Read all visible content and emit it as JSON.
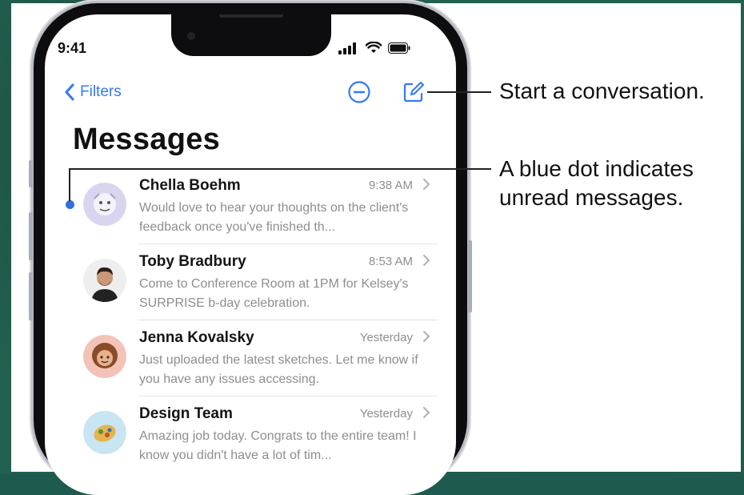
{
  "status_bar": {
    "time": "9:41",
    "icons": [
      "signal-icon",
      "wifi-icon",
      "battery-icon"
    ]
  },
  "nav": {
    "back_label": "Filters",
    "icons": [
      "more-options-icon",
      "compose-icon"
    ]
  },
  "title": "Messages",
  "conversations": [
    {
      "name": "Chella Boehm",
      "time": "9:38 AM",
      "preview": "Would love to hear your thoughts on the client's feedback once you've finished th...",
      "unread": true,
      "avatar": "memoji-avatar"
    },
    {
      "name": "Toby Bradbury",
      "time": "8:53 AM",
      "preview": "Come to Conference Room at 1PM for Kelsey's SURPRISE b-day celebration.",
      "unread": false,
      "avatar": "photo-avatar"
    },
    {
      "name": "Jenna Kovalsky",
      "time": "Yesterday",
      "preview": "Just uploaded the latest sketches. Let me know if you have any issues accessing.",
      "unread": false,
      "avatar": "memoji-avatar"
    },
    {
      "name": "Design Team",
      "time": "Yesterday",
      "preview": "Amazing job today. Congrats to the entire team! I know you didn't have a lot of tim...",
      "unread": false,
      "avatar": "group-avatar"
    }
  ],
  "callouts": {
    "compose": "Start a conversation.",
    "unread_line1": "A blue dot indicates",
    "unread_line2": "unread messages."
  },
  "colors": {
    "accent": "#3478f6",
    "unread_dot": "#2f6fde",
    "background": "#22604f"
  }
}
